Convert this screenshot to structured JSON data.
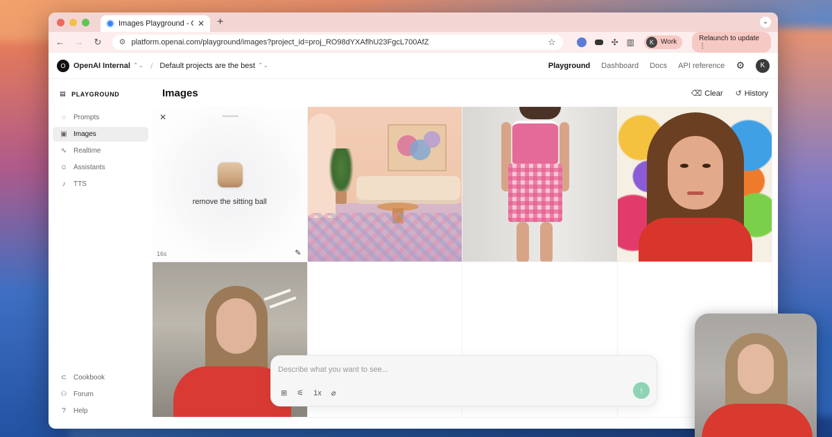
{
  "browser": {
    "tab_title": "Images Playground - OpenAI",
    "new_tab_symbol": "+",
    "url": "platform.openai.com/playground/images?project_id=proj_RO98dYXAflhU23FgcL700AfZ",
    "profile_initial": "K",
    "profile_label": "Work",
    "relaunch_label": "Relaunch to update"
  },
  "header": {
    "org_logo_letter": "O",
    "org_name": "OpenAI Internal",
    "project_name": "Default projects are the best",
    "nav": [
      "Playground",
      "Dashboard",
      "Docs",
      "API reference"
    ],
    "user_initial": "K"
  },
  "sidebar": {
    "title": "PLAYGROUND",
    "items": [
      {
        "label": "Prompts",
        "icon": "chat-bubble-icon"
      },
      {
        "label": "Images",
        "icon": "image-icon"
      },
      {
        "label": "Realtime",
        "icon": "waveform-icon"
      },
      {
        "label": "Assistants",
        "icon": "robot-icon"
      },
      {
        "label": "TTS",
        "icon": "microphone-icon"
      }
    ],
    "bottom_items": [
      {
        "label": "Cookbook",
        "icon": "link-icon"
      },
      {
        "label": "Forum",
        "icon": "people-icon"
      },
      {
        "label": "Help",
        "icon": "help-icon"
      }
    ]
  },
  "main": {
    "title": "Images",
    "clear_label": "Clear",
    "history_label": "History"
  },
  "generating": {
    "prompt": "remove the sitting ball",
    "elapsed": "16s"
  },
  "composer": {
    "placeholder": "Describe what you want to see...",
    "count_label": "1x"
  }
}
